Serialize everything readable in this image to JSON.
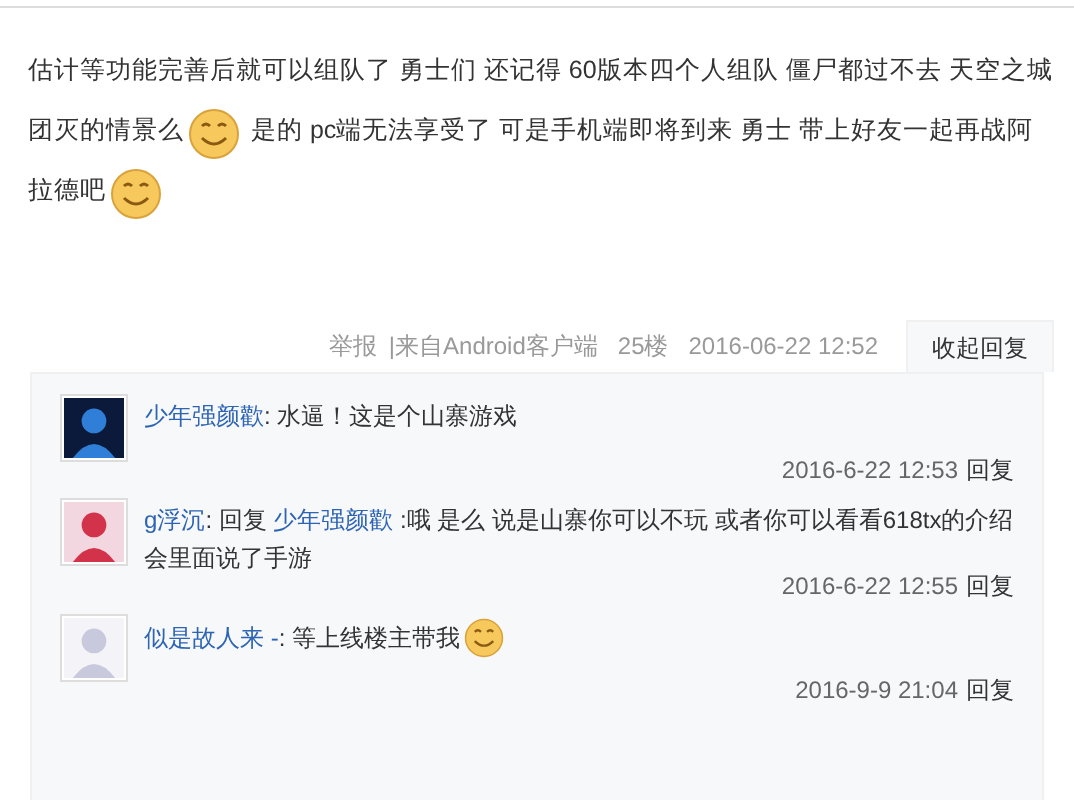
{
  "post": {
    "segments": [
      {
        "kind": "text",
        "text": "估计等功能完善后就可以组队了 勇士们 还记得 60版本四个人组队 僵尸都过不去 天空之城团灭的情景么"
      },
      {
        "kind": "emoji"
      },
      {
        "kind": "text",
        "text": " 是的 pc端无法享受了 可是手机端即将到来 勇士 带上好友一起再战阿拉德吧"
      },
      {
        "kind": "emoji"
      }
    ]
  },
  "meta": {
    "report": "举报",
    "source": "|来自Android客户端",
    "floor": "25楼",
    "time": "2016-06-22 12:52",
    "toggle": "收起回复"
  },
  "replies": [
    {
      "segments": [
        {
          "kind": "user",
          "text": "少年强颜歡"
        },
        {
          "kind": "text",
          "text": ": 水逼！这是个山寨游戏"
        }
      ],
      "time": "2016-6-22 12:53",
      "action": "回复"
    },
    {
      "segments": [
        {
          "kind": "user",
          "text": "g浮沉"
        },
        {
          "kind": "text",
          "text": ": 回复 "
        },
        {
          "kind": "user",
          "text": "少年强颜歡"
        },
        {
          "kind": "text",
          "text": " :哦 是么 说是山寨你可以不玩 或者你可以看看618tx的介绍会里面说了手游"
        }
      ],
      "time": "2016-6-22 12:55",
      "action": "回复"
    },
    {
      "segments": [
        {
          "kind": "user",
          "text": "似是故人来 ‑"
        },
        {
          "kind": "text",
          "text": ": 等上线楼主带我"
        },
        {
          "kind": "emoji"
        }
      ],
      "time": "2016-9-9 21:04",
      "action": "回复"
    }
  ]
}
